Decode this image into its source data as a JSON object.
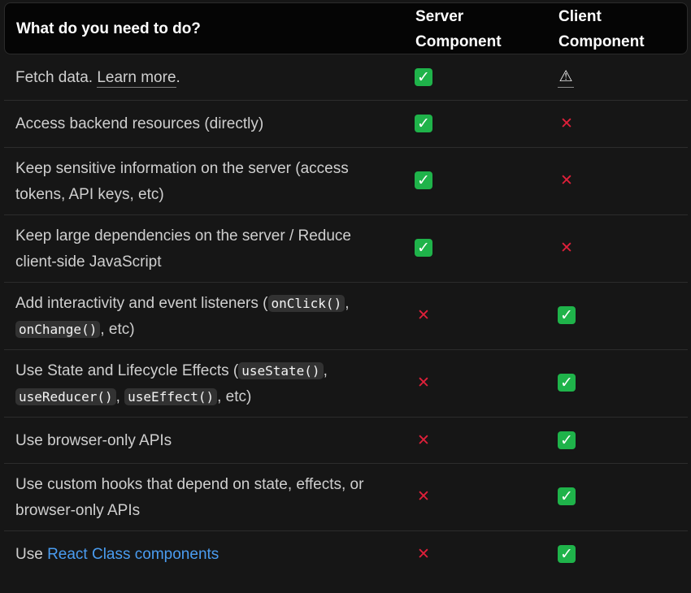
{
  "header": {
    "task_label": "What do you need to do?",
    "server_line1": "Server",
    "server_line2": "Component",
    "client_line1": "Client",
    "client_line2": "Component"
  },
  "icons": {
    "check": "✓",
    "cross": "✕",
    "warning": "⚠"
  },
  "colors": {
    "check": "#1fb34a",
    "cross": "#e0203a",
    "link": "#4a9cf0"
  },
  "rows": [
    {
      "prefix": "Fetch data. ",
      "link": "Learn more",
      "suffix": ".",
      "server": "check-icon",
      "client": "warning-icon"
    },
    {
      "text": "Access backend resources (directly)",
      "server": "check-icon",
      "client": "cross-icon"
    },
    {
      "text": "Keep sensitive information on the server (access tokens, API keys, etc)",
      "server": "check-icon",
      "client": "cross-icon"
    },
    {
      "text": "Keep large dependencies on the server / Reduce client-side JavaScript",
      "server": "check-icon",
      "client": "cross-icon"
    },
    {
      "prefix": "Add interactivity and event listeners (",
      "code1": "onClick()",
      "sep1": ",",
      "code2": "onChange()",
      "suffix": ", etc)",
      "server": "cross-icon",
      "client": "check-icon"
    },
    {
      "prefix": "Use State and Lifecycle Effects (",
      "code1": "useState()",
      "sep1": ",",
      "code2": "useReducer()",
      "sep2": ", ",
      "code3": "useEffect()",
      "suffix": ", etc)",
      "server": "cross-icon",
      "client": "check-icon"
    },
    {
      "text": "Use browser-only APIs",
      "server": "cross-icon",
      "client": "check-icon"
    },
    {
      "text": "Use custom hooks that depend on state, effects, or browser-only APIs",
      "server": "cross-icon",
      "client": "check-icon"
    },
    {
      "prefix": "Use ",
      "link": "React Class components",
      "server": "cross-icon",
      "client": "check-icon"
    }
  ]
}
